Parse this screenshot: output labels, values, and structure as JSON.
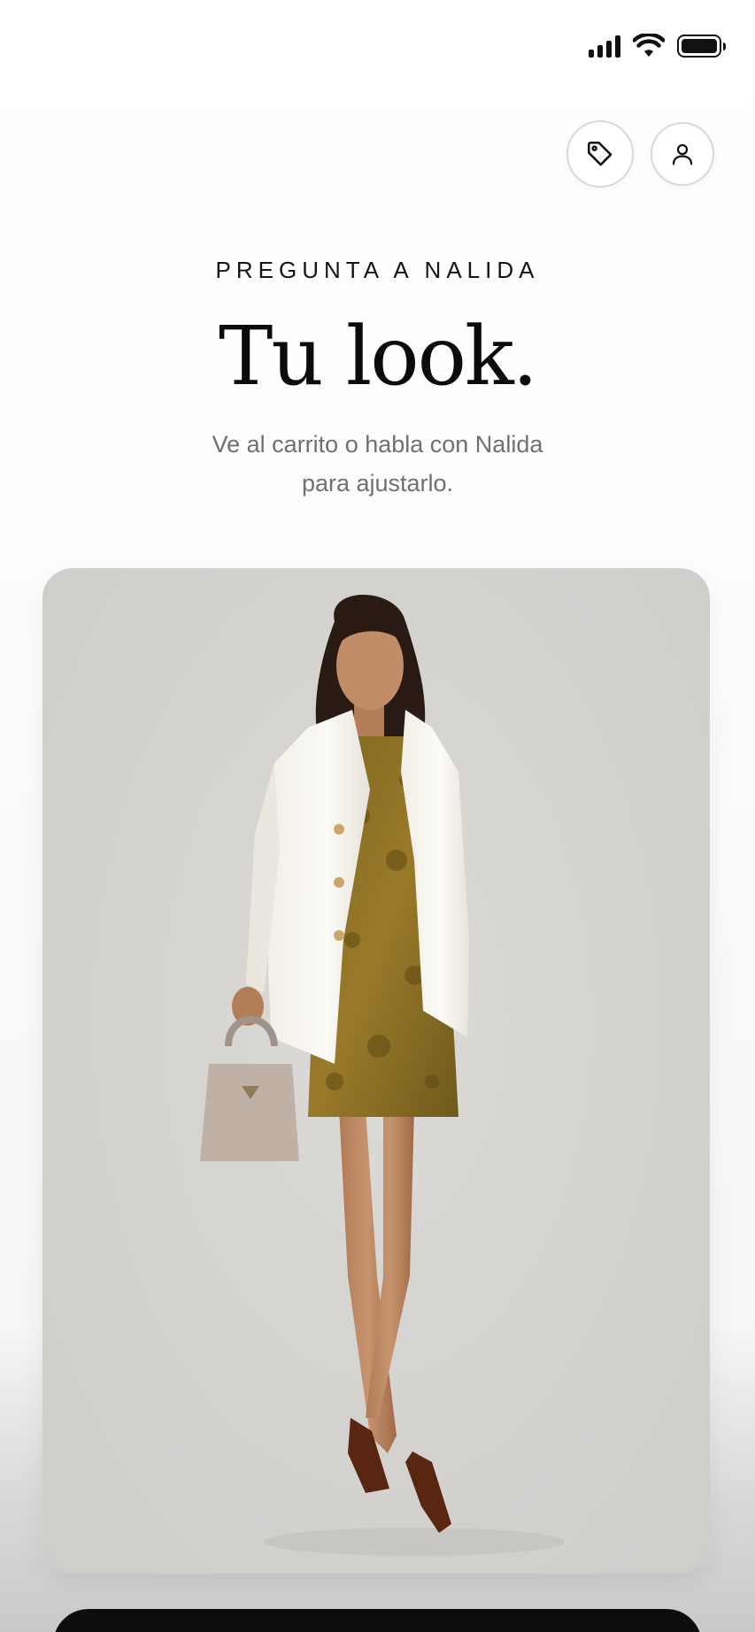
{
  "status_bar": {
    "signal_icon": "cellular-signal-icon",
    "wifi_icon": "wifi-icon",
    "battery_icon": "battery-icon"
  },
  "header": {
    "tag_button_icon": "tag-icon",
    "profile_button_icon": "user-icon"
  },
  "hero": {
    "eyebrow": "PREGUNTA A NALIDA",
    "title": "Tu look.",
    "subtitle_line1": "Ve al carrito o habla con Nalida",
    "subtitle_line2": "para ajustarlo."
  },
  "look": {
    "image_subject": "outfit-photo",
    "background_color": "#d6d4d1"
  },
  "colors": {
    "text_primary": "#111111",
    "text_secondary": "#707070",
    "bottom_bar": "#0d0d0d"
  }
}
